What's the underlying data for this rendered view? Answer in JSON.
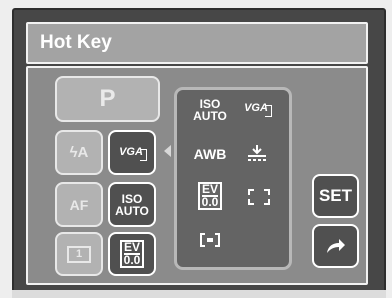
{
  "window": {
    "title": "Hot Key"
  },
  "left_buttons": {
    "mode": "P",
    "flash": "ϟA",
    "af": "AF",
    "drive": "1"
  },
  "right_buttons": {
    "vga": "VGA",
    "iso_top": "ISO",
    "iso_bottom": "AUTO",
    "ev_top": "EV",
    "ev_bottom": "0.0"
  },
  "sub_panel": {
    "iso_top": "ISO",
    "iso_bottom": "AUTO",
    "vga": "VGA",
    "awb": "AWB",
    "ev_top": "EV",
    "ev_bottom": "0.0"
  },
  "side_buttons": {
    "set": "SET",
    "next_icon": "share-arrow-icon"
  }
}
